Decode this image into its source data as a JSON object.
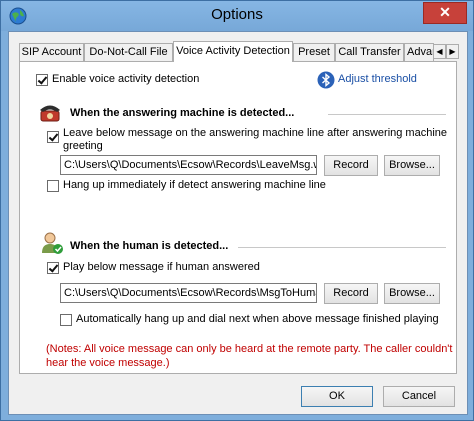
{
  "window": {
    "title": "Options",
    "close_glyph": "✕"
  },
  "tabs": [
    {
      "label": "SIP Account"
    },
    {
      "label": "Do-Not-Call File"
    },
    {
      "label": "Voice Activity Detection"
    },
    {
      "label": "Preset"
    },
    {
      "label": "Call Transfer"
    },
    {
      "label": "Advar"
    }
  ],
  "tab_scroll": {
    "left": "◀",
    "right": "▶"
  },
  "vad": {
    "enable_label": "Enable voice activity detection",
    "enable_checked": true,
    "adjust_threshold_label": "Adjust threshold"
  },
  "answering_machine": {
    "title": "When the answering machine is detected...",
    "leave_message_label_1": "Leave below message on the answering machine line after answering machine",
    "leave_message_label_2": "greeting",
    "leave_message_checked": true,
    "path": "C:\\Users\\Q\\Documents\\Ecsow\\Records\\LeaveMsg.wav",
    "record_label": "Record",
    "browse_label": "Browse...",
    "hangup_label": "Hang up immediately if detect answering machine line",
    "hangup_checked": false
  },
  "human": {
    "title": "When the human is detected...",
    "play_message_label": "Play below message if human answered",
    "play_message_checked": true,
    "path": "C:\\Users\\Q\\Documents\\Ecsow\\Records\\MsgToHuman.wa",
    "record_label": "Record",
    "browse_label": "Browse...",
    "auto_hangup_label": "Automatically hang up and dial next when above message finished playing",
    "auto_hangup_checked": false
  },
  "note": {
    "line1": "(Notes: All voice message can only be heard at the remote party. The caller couldn't",
    "line2": "hear the voice message.)"
  },
  "footer": {
    "ok_label": "OK",
    "cancel_label": "Cancel"
  },
  "colors": {
    "titlebar": "#7eaedc",
    "close": "#c7413a",
    "note_red": "#c00000",
    "link_blue": "#1a4fa5"
  }
}
